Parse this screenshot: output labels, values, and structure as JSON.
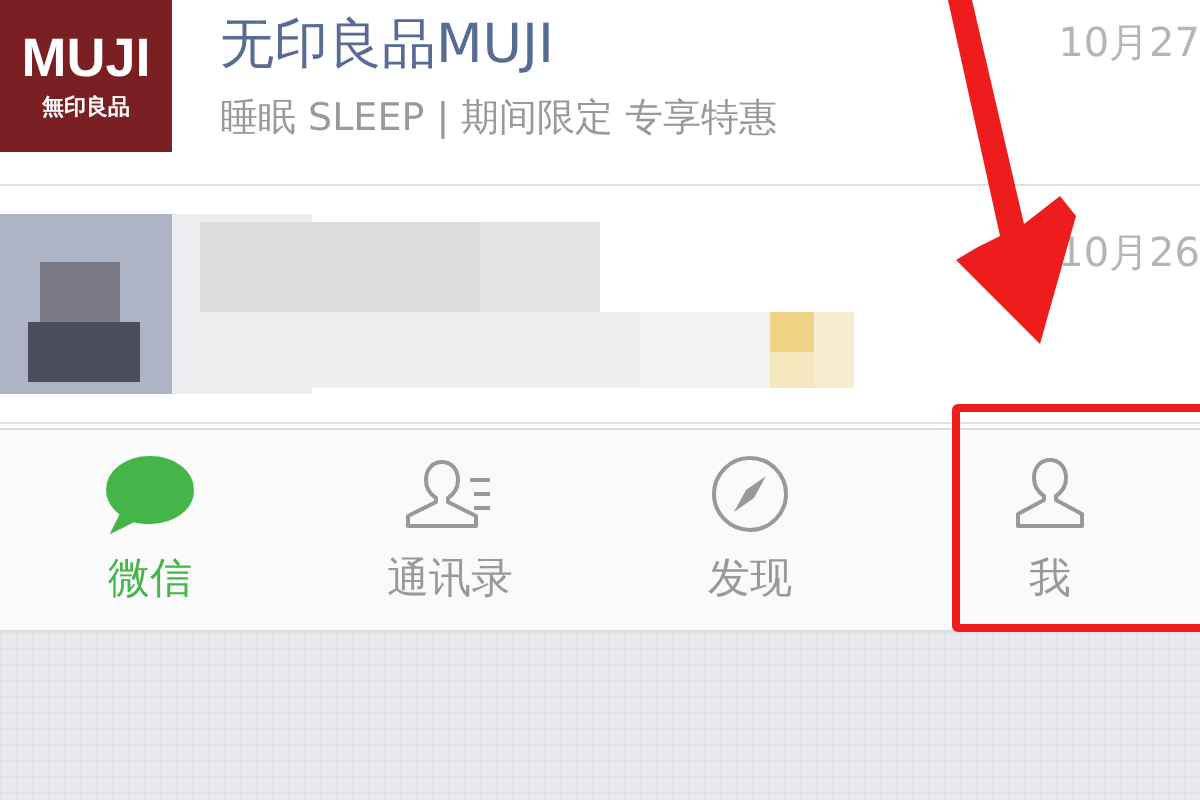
{
  "chats": [
    {
      "kind": "logo",
      "logo_text": "MUJI",
      "logo_sub": "無印良品",
      "name": "无印良品MUJI",
      "preview": "睡眠 SLEEP | 期间限定 专享特惠",
      "date": "10月27"
    },
    {
      "kind": "picture",
      "date": "10月26"
    }
  ],
  "tabs": [
    {
      "label": "微信",
      "selected": true
    },
    {
      "label": "通讯录",
      "selected": false
    },
    {
      "label": "发现",
      "selected": false
    },
    {
      "label": "我",
      "selected": false
    }
  ]
}
